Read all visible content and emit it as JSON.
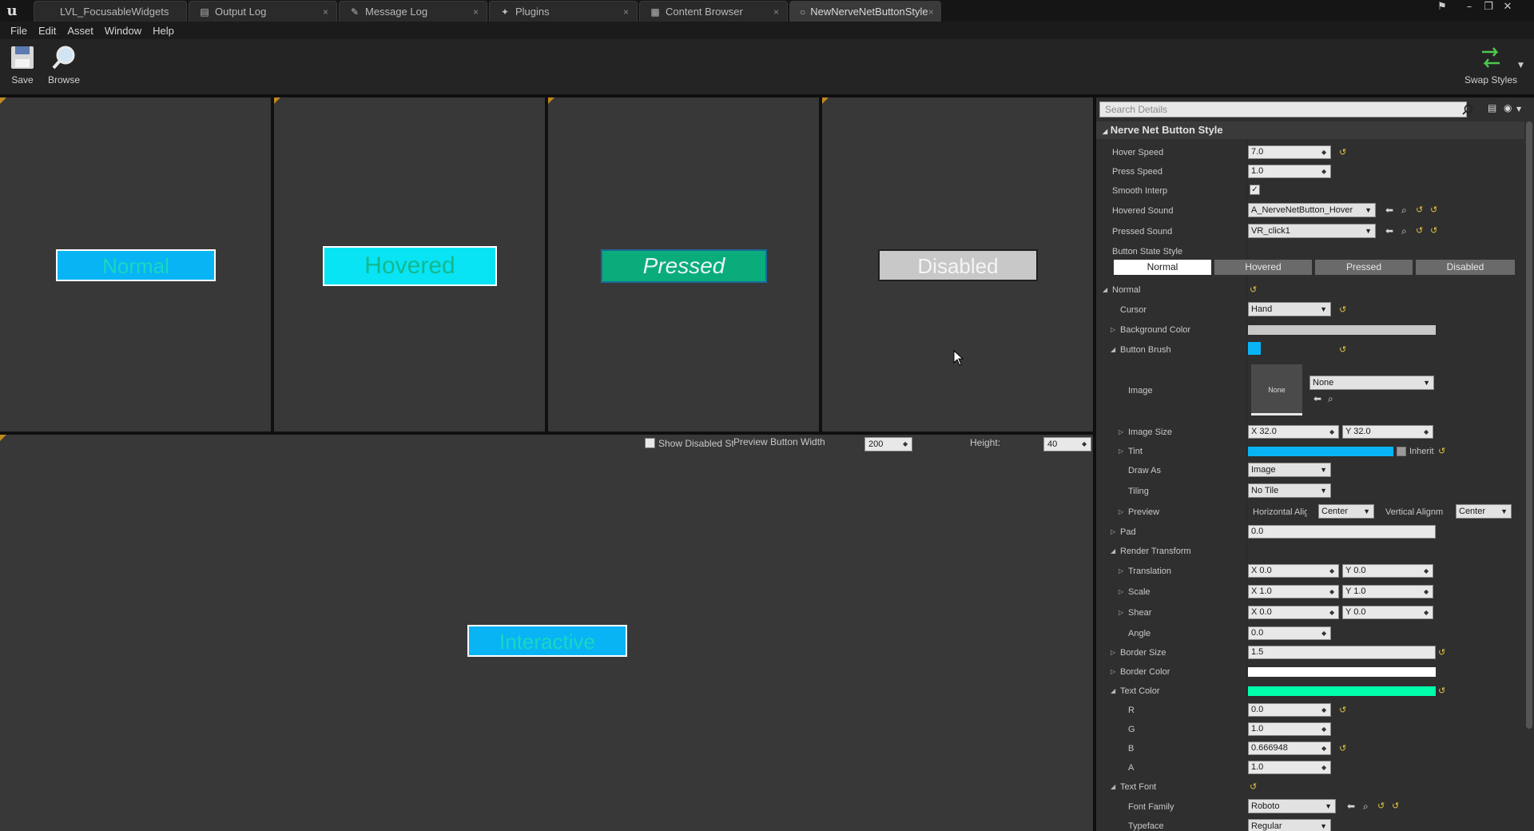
{
  "tabs": [
    {
      "label": "LVL_FocusableWidgets",
      "icon": "level-icon"
    },
    {
      "label": "Output Log",
      "icon": "log-icon"
    },
    {
      "label": "Message Log",
      "icon": "message-icon"
    },
    {
      "label": "Plugins",
      "icon": "plugin-icon"
    },
    {
      "label": "Content Browser",
      "icon": "content-browser-icon"
    },
    {
      "label": "NewNerveNetButtonStyle",
      "icon": "asset-icon"
    }
  ],
  "menu": [
    "File",
    "Edit",
    "Asset",
    "Window",
    "Help"
  ],
  "toolbar": {
    "save_label": "Save",
    "browse_label": "Browse",
    "swap_label": "Swap Styles"
  },
  "preview": {
    "states": [
      {
        "label": "Normal",
        "bg": "#08b4f4",
        "fg": "#17d8c0"
      },
      {
        "label": "Hovered",
        "bg": "#08e4f4",
        "fg": "#14b890"
      },
      {
        "label": "Pressed",
        "bg": "#0aac7c",
        "fg": "#e8f4f8"
      },
      {
        "label": "Disabled",
        "bg": "#c8c8c8",
        "fg": "#f4f4f4"
      }
    ],
    "show_disabled_label": "Show Disabled State",
    "width_label": "Preview Button Width",
    "width_value": "200",
    "height_label": "Height:",
    "height_value": "40",
    "interactive_label": "Interactive"
  },
  "details": {
    "search_placeholder": "Search Details",
    "category": "Nerve Net Button Style",
    "hover_speed_label": "Hover Speed",
    "hover_speed": "7.0",
    "press_speed_label": "Press Speed",
    "press_speed": "1.0",
    "smooth_interp_label": "Smooth Interp",
    "smooth_interp": "✓",
    "hovered_sound_label": "Hovered Sound",
    "hovered_sound": "A_NerveNetButton_Hover",
    "pressed_sound_label": "Pressed Sound",
    "pressed_sound": "VR_click1",
    "button_state_style_label": "Button State Style",
    "state_tabs": [
      "Normal",
      "Hovered",
      "Pressed",
      "Disabled"
    ],
    "normal_label": "Normal",
    "cursor_label": "Cursor",
    "cursor": "Hand",
    "background_color_label": "Background Color",
    "button_brush_label": "Button Brush",
    "brush_color": "#08b4f4",
    "image_label": "Image",
    "image_thumb": "None",
    "image_value": "None",
    "image_size_label": "Image Size",
    "image_size_x": "32.0",
    "image_size_y": "32.0",
    "tint_label": "Tint",
    "tint_color": "#08b4f4",
    "inherit_label": "Inherit",
    "draw_as_label": "Draw As",
    "draw_as": "Image",
    "tiling_label": "Tiling",
    "tiling": "No Tile",
    "preview_label": "Preview",
    "h_align_label": "Horizontal Alig",
    "h_align": "Center",
    "v_align_label": "Vertical Alignm",
    "v_align": "Center",
    "pad_label": "Pad",
    "pad": "0.0",
    "render_transform_label": "Render Transform",
    "translation_label": "Translation",
    "translation_x": "0.0",
    "translation_y": "0.0",
    "scale_label": "Scale",
    "scale_x": "1.0",
    "scale_y": "1.0",
    "shear_label": "Shear",
    "shear_x": "0.0",
    "shear_y": "0.0",
    "angle_label": "Angle",
    "angle": "0.0",
    "border_size_label": "Border Size",
    "border_size": "1.5",
    "border_color_label": "Border Color",
    "border_color": "#ffffff",
    "text_color_label": "Text Color",
    "text_color": "#00ffaa",
    "r_label": "R",
    "r": "0.0",
    "g_label": "G",
    "g": "1.0",
    "b_label": "B",
    "b": "0.666948",
    "a_label": "A",
    "a": "1.0",
    "text_font_label": "Text Font",
    "font_family_label": "Font Family",
    "font_family": "Roboto",
    "typeface_label": "Typeface",
    "typeface": "Regular",
    "x_axis": "X",
    "y_axis": "Y"
  }
}
